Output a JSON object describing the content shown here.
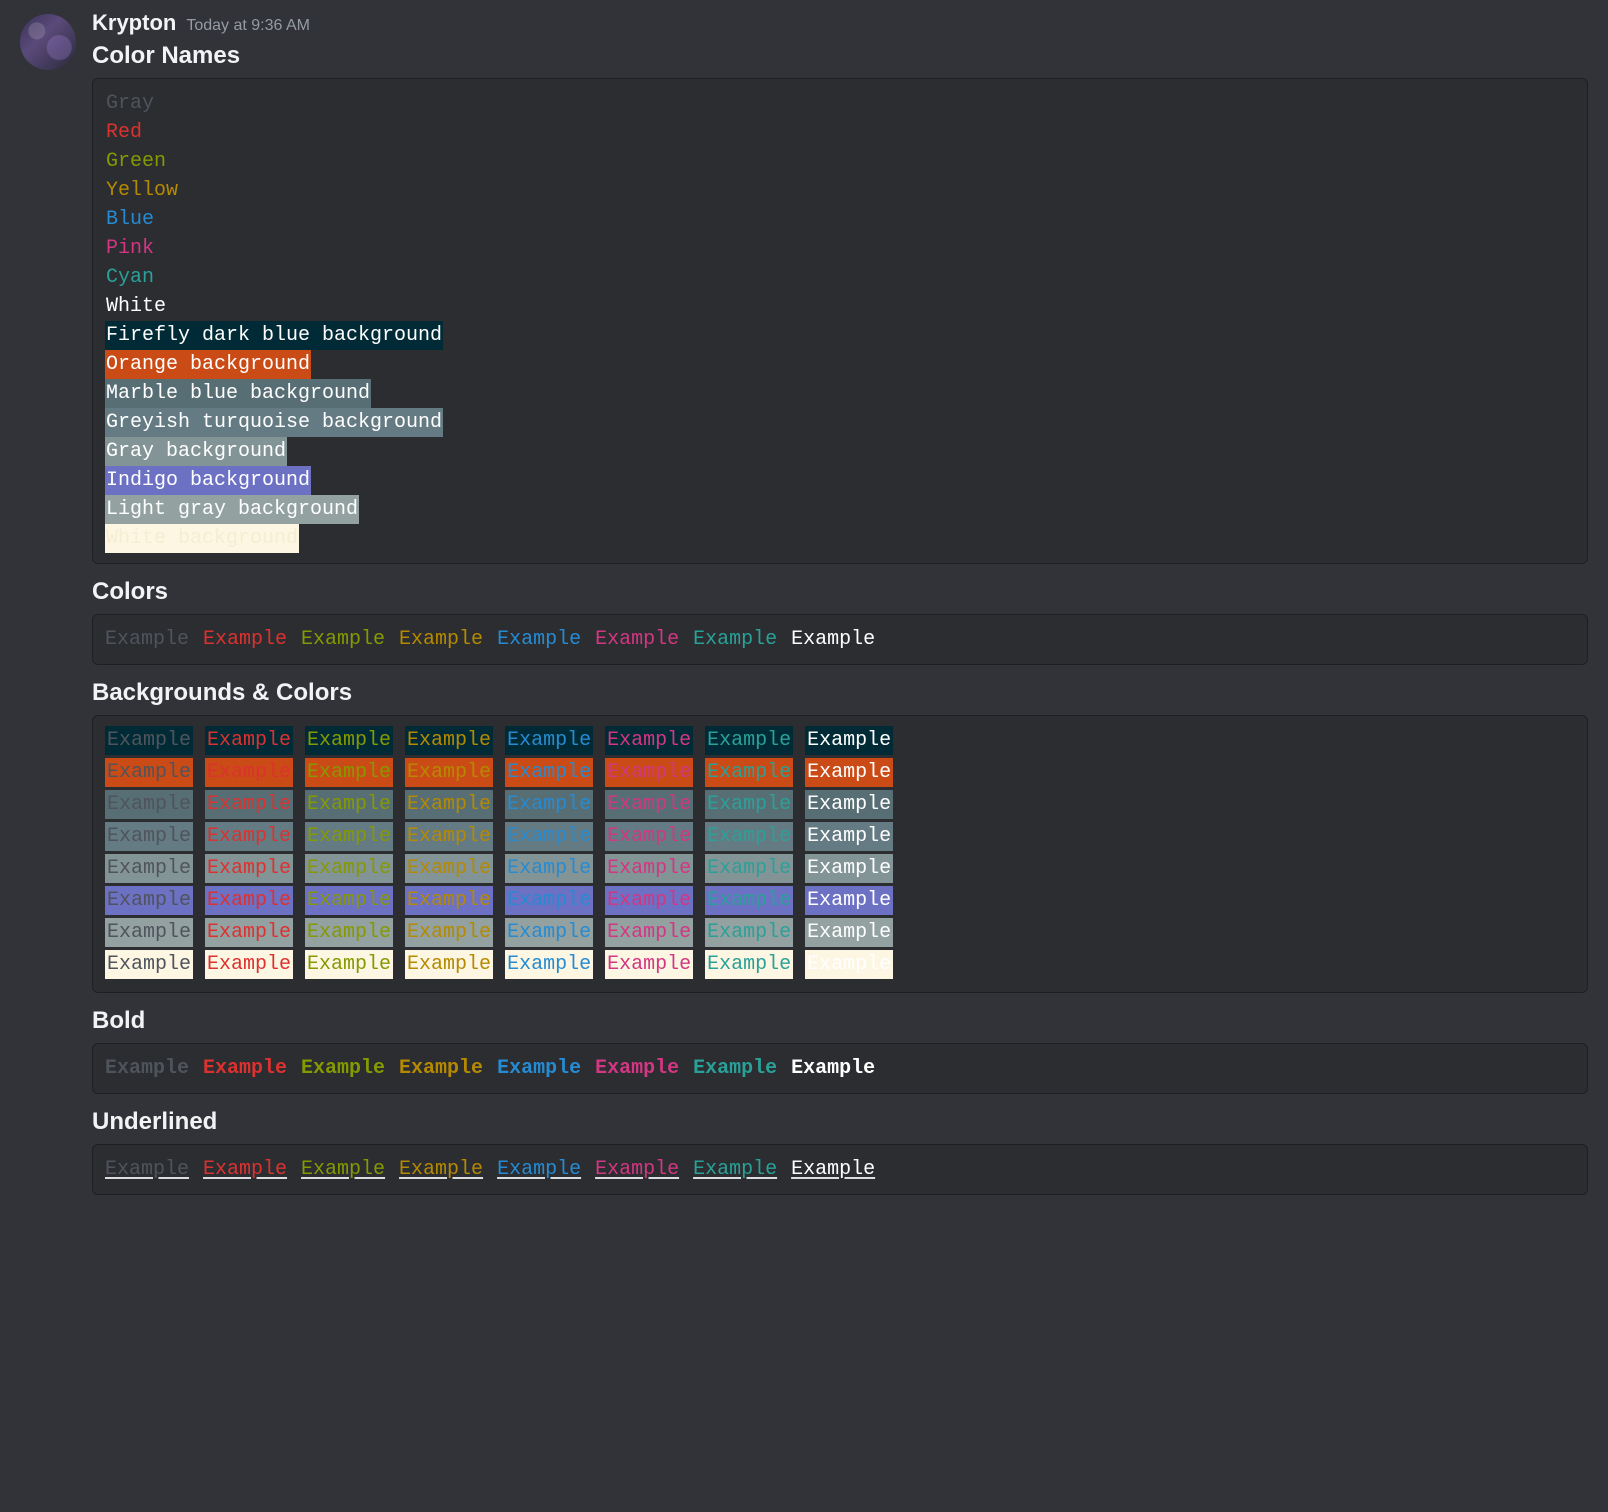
{
  "user": {
    "name": "Krypton",
    "timestamp": "Today at 9:36 AM"
  },
  "headings": {
    "color_names": "Color Names",
    "colors": "Colors",
    "bg_colors": "Backgrounds & Colors",
    "bold": "Bold",
    "underlined": "Underlined"
  },
  "palette": {
    "fg": {
      "gray": "#4f545c",
      "red": "#dc322f",
      "green": "#859900",
      "yellow": "#b58900",
      "blue": "#268bd2",
      "pink": "#d33682",
      "cyan": "#2aa198",
      "white": "#ffffff"
    },
    "bg": {
      "firefly": "#002b36",
      "orange": "#cb4b16",
      "marble": "#586e75",
      "greyturq": "#657b83",
      "gray": "#839496",
      "indigo": "#6c71c4",
      "lgray": "#93a1a1",
      "white": "#fdf6e3"
    }
  },
  "color_names_block": [
    {
      "text": "Gray",
      "fg": "gray"
    },
    {
      "text": "Red",
      "fg": "red"
    },
    {
      "text": "Green",
      "fg": "green"
    },
    {
      "text": "Yellow",
      "fg": "yellow"
    },
    {
      "text": "Blue",
      "fg": "blue"
    },
    {
      "text": "Pink",
      "fg": "pink"
    },
    {
      "text": "Cyan",
      "fg": "cyan"
    },
    {
      "text": "White",
      "fg": "white"
    },
    {
      "text": "Firefly dark blue background",
      "bg": "firefly",
      "ink": "#ffffff"
    },
    {
      "text": "Orange background",
      "bg": "orange",
      "ink": "#ffffff"
    },
    {
      "text": "Marble blue background",
      "bg": "marble",
      "ink": "#ffffff"
    },
    {
      "text": "Greyish turquoise background",
      "bg": "greyturq",
      "ink": "#ffffff"
    },
    {
      "text": "Gray background",
      "bg": "gray",
      "ink": "#ffffff"
    },
    {
      "text": "Indigo background",
      "bg": "indigo",
      "ink": "#ffffff"
    },
    {
      "text": "Light gray background",
      "bg": "lgray",
      "ink": "#ffffff"
    },
    {
      "text": "White background",
      "bg": "white",
      "ink": "#f5eed2"
    }
  ],
  "example_word": "Example",
  "fg_order": [
    "gray",
    "red",
    "green",
    "yellow",
    "blue",
    "pink",
    "cyan",
    "white"
  ],
  "bg_order": [
    "firefly",
    "orange",
    "marble",
    "greyturq",
    "gray",
    "indigo",
    "lgray",
    "white"
  ]
}
